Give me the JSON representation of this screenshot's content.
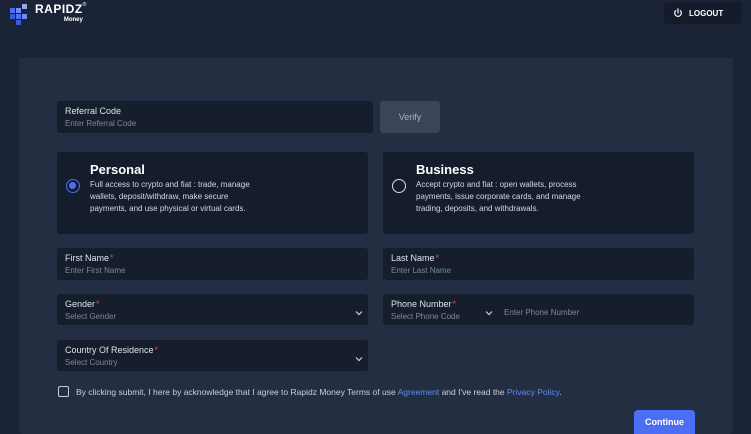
{
  "brand": {
    "name": "RAPIDZ",
    "sub": "Money",
    "registered": "®"
  },
  "header": {
    "logout_label": "LOGOUT"
  },
  "referral": {
    "label": "Referral Code",
    "placeholder": "Enter Referral Code",
    "verify_label": "Verify"
  },
  "account_types": [
    {
      "title": "Personal",
      "description": "Full access to crypto and fiat : trade, manage wallets, deposit/withdraw, make secure payments, and use physical or virtual cards.",
      "selected": true
    },
    {
      "title": "Business",
      "description": "Accept crypto and fiat : open wallets, process payments, issue corporate cards, and manage trading, deposits, and withdrawals.",
      "selected": false
    }
  ],
  "form": {
    "first_name": {
      "label": "First Name",
      "placeholder": "Enter First Name"
    },
    "last_name": {
      "label": "Last Name",
      "placeholder": "Enter Last Name"
    },
    "gender": {
      "label": "Gender",
      "placeholder": "Select Gender"
    },
    "phone": {
      "label": "Phone Number",
      "code_placeholder": "Select Phone Code",
      "number_placeholder": "Enter Phone Number"
    },
    "country": {
      "label": "Country Of Residence",
      "placeholder": "Select Country"
    },
    "required_mark": "*"
  },
  "agreement": {
    "text_before": "By clicking submit, I here by acknowledge that I agree to Rapidz Money Terms of use",
    "agreement_link": "Agreement",
    "text_middle": "and I've read the",
    "privacy_link": "Privacy Policy",
    "text_after": "."
  },
  "continue_label": "Continue",
  "colors": {
    "accent": "#4c6ef5",
    "link": "#5b8def",
    "required": "#ef4444",
    "background": "#1b2436",
    "panel": "#232e42",
    "field": "#161e2e"
  },
  "icons": {
    "brand": "rapidz-logo-icon",
    "logout": "power-icon",
    "dropdown": "chevron-down-icon"
  }
}
